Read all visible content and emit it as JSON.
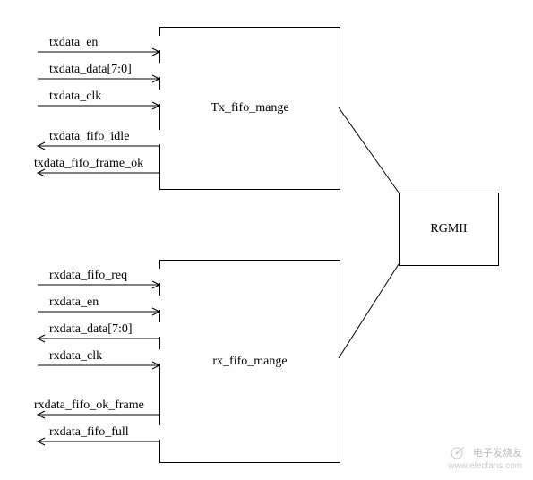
{
  "blocks": {
    "tx": "Tx_fifo_mange",
    "rx": "rx_fifo_mange",
    "rgmii": "RGMII"
  },
  "tx_signals": [
    {
      "name": "txdata_en",
      "dir": "in"
    },
    {
      "name": "txdata_data[7:0]",
      "dir": "in"
    },
    {
      "name": "txdata_clk",
      "dir": "in"
    },
    {
      "name": "txdata_fifo_idle",
      "dir": "out"
    },
    {
      "name": "txdata_fifo_frame_ok",
      "dir": "out"
    }
  ],
  "rx_signals": [
    {
      "name": "rxdata_fifo_req",
      "dir": "in"
    },
    {
      "name": "rxdata_en",
      "dir": "in"
    },
    {
      "name": "rxdata_data[7:0]",
      "dir": "out"
    },
    {
      "name": "rxdata_clk",
      "dir": "in"
    },
    {
      "name": "rxdata_fifo_ok_frame",
      "dir": "out"
    },
    {
      "name": "rxdata_fifo_full",
      "dir": "out"
    }
  ],
  "watermark": {
    "brand": "电子发烧友",
    "url": "www.elecfans.com"
  }
}
